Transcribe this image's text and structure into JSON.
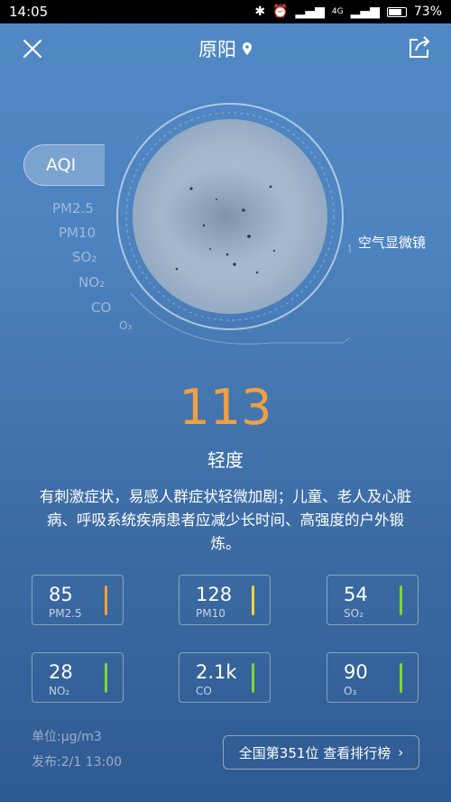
{
  "status_bar": {
    "time": "14:05",
    "network": "4G",
    "battery": "73%"
  },
  "header": {
    "title": "原阳",
    "close_icon": "close-icon",
    "share_icon": "share-icon",
    "location_icon": "location-pin-icon"
  },
  "aqi_tab": "AQI",
  "pollutants": [
    "PM2.5",
    "PM10",
    "SO₂",
    "NO₂",
    "CO",
    "O₃"
  ],
  "microscope_label": "空气显微镜",
  "aqi": {
    "value": "113",
    "level": "轻度",
    "advice": "有刺激症状，易感人群症状轻微加剧；儿童、老人及心脏病、呼吸系统疾病患者应减少长时间、高强度的户外锻炼。",
    "value_color": "#f0a040"
  },
  "cards": [
    {
      "value": "85",
      "label": "PM2.5",
      "color": "#f0a040"
    },
    {
      "value": "128",
      "label": "PM10",
      "color": "#f5d340"
    },
    {
      "value": "54",
      "label": "SO₂",
      "color": "#7dd63b"
    },
    {
      "value": "28",
      "label": "NO₂",
      "color": "#7dd63b"
    },
    {
      "value": "2.1k",
      "label": "CO",
      "color": "#7dd63b"
    },
    {
      "value": "90",
      "label": "O₃",
      "color": "#7dd63b"
    }
  ],
  "footer": {
    "unit": "单位:μg/m3",
    "published": "发布:2/1 13:00",
    "rank_button": "全国第351位 查看排行榜"
  }
}
